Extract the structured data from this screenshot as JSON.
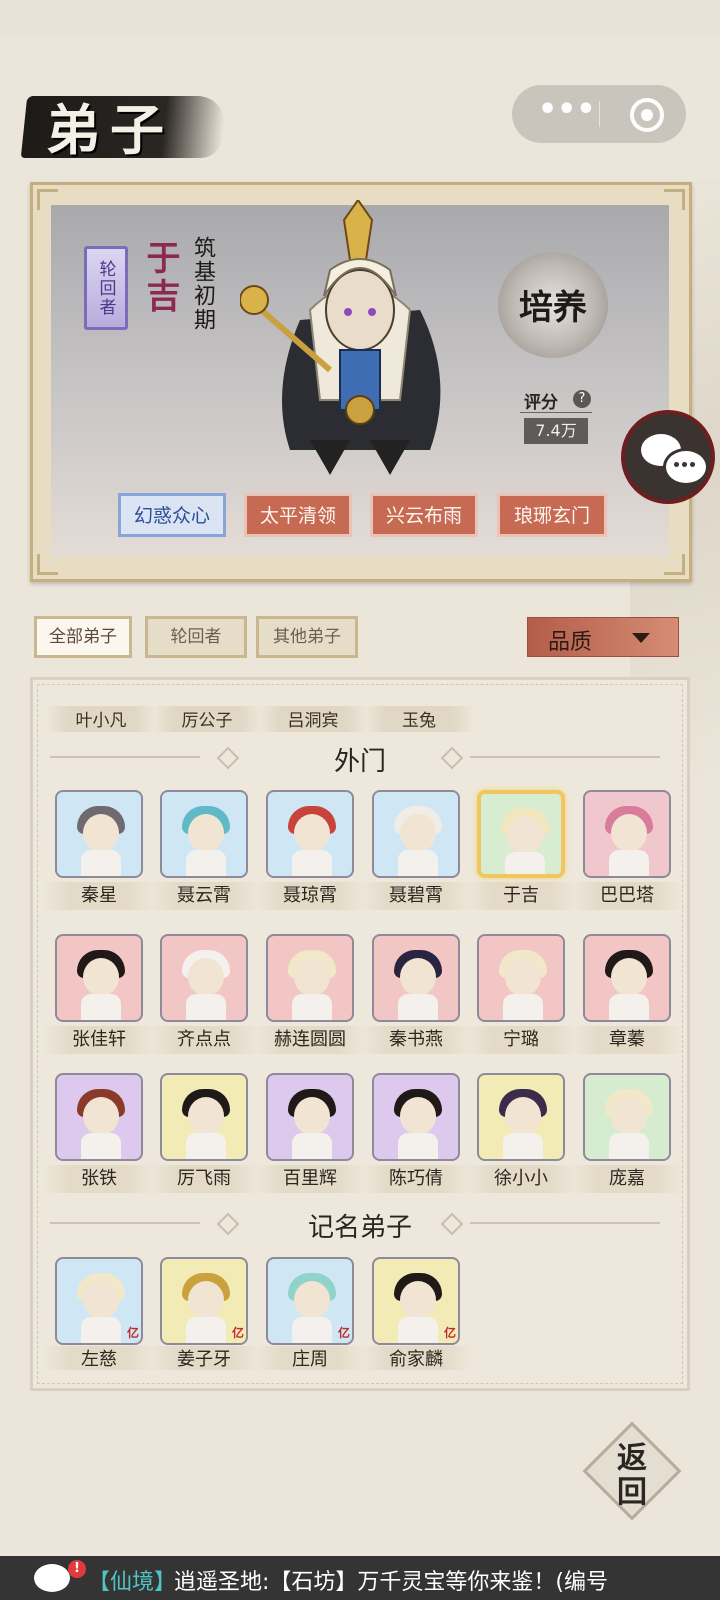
{
  "header": {
    "title": "弟子"
  },
  "hero": {
    "reincarnator_badge": "轮回者",
    "name": "于吉",
    "realm": "筑基初期",
    "cultivate_label": "培养",
    "score_label": "评分",
    "score_help": "?",
    "score_value": "7.4万",
    "skills": [
      "幻惑众心",
      "太平清领",
      "兴云布雨",
      "琅琊玄门"
    ]
  },
  "filters": {
    "tabs": [
      "全部弟子",
      "轮回者",
      "其他弟子"
    ],
    "active_tab": "全部弟子",
    "quality_label": "品质"
  },
  "top_row_names": [
    "叶小凡",
    "厉公子",
    "吕洞宾",
    "玉兔"
  ],
  "sections": [
    {
      "label": "外门"
    },
    {
      "label": "记名弟子"
    }
  ],
  "outer_disciples": [
    {
      "name": "秦星"
    },
    {
      "name": "聂云霄"
    },
    {
      "name": "聂琼霄"
    },
    {
      "name": "聂碧霄"
    },
    {
      "name": "于吉",
      "selected": true
    },
    {
      "name": "巴巴塔"
    },
    {
      "name": "张佳轩"
    },
    {
      "name": "齐点点"
    },
    {
      "name": "赫连圆圆"
    },
    {
      "name": "秦书燕"
    },
    {
      "name": "宁璐"
    },
    {
      "name": "章蓁"
    },
    {
      "name": "张铁"
    },
    {
      "name": "厉飞雨"
    },
    {
      "name": "百里辉"
    },
    {
      "name": "陈巧倩"
    },
    {
      "name": "徐小小"
    },
    {
      "name": "庞嘉"
    }
  ],
  "registered_disciples": [
    {
      "name": "左慈",
      "badge": "亿"
    },
    {
      "name": "姜子牙",
      "badge": "亿"
    },
    {
      "name": "庄周",
      "badge": "亿"
    },
    {
      "name": "俞家麟",
      "badge": "亿"
    }
  ],
  "back_label": "返回",
  "ticker": {
    "channel": "【仙境】",
    "message": "逍遥圣地:【石坊】万千灵宝等你来鉴！(编号",
    "alert": "!"
  },
  "colors": {
    "accent_red": "#c66a54",
    "selected_gold": "#f0c65e",
    "channel_cyan": "#4fc3c6"
  }
}
